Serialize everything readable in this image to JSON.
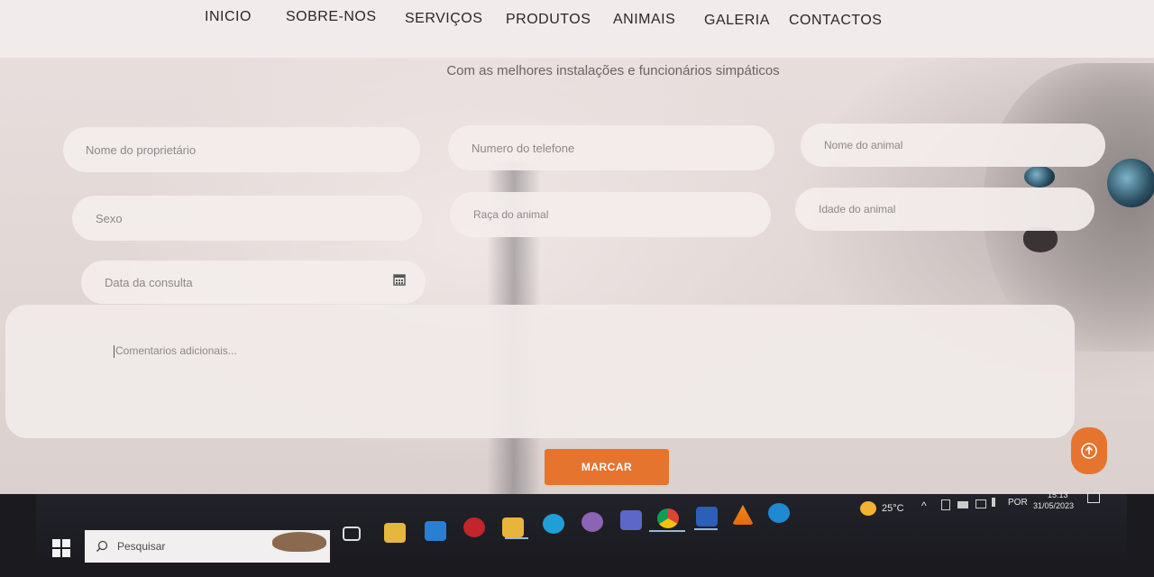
{
  "nav": {
    "items": [
      "INICIO",
      "SOBRE-NOS",
      "SERVIÇOS",
      "PRODUTOS",
      "ANIMAIS",
      "GALERIA",
      "CONTACTOS"
    ]
  },
  "hero": {
    "subtitle": "Com as melhores instalações e funcionários simpáticos"
  },
  "form": {
    "owner_name_placeholder": "Nome do proprietário",
    "phone_placeholder": "Numero do telefone",
    "animal_name_placeholder": "Nome do animal",
    "sex_placeholder": "Sexo",
    "breed_placeholder": "Raça do animal",
    "age_placeholder": "Idade do animal",
    "date_placeholder": "Data da consulta",
    "comments_placeholder": "Comentarios adicionais...",
    "submit_label": "MARCAR"
  },
  "taskbar": {
    "search_placeholder": "Pesquisar",
    "temperature": "25°C",
    "language": "POR",
    "time": "15:13",
    "date": "31/05/2023"
  },
  "colors": {
    "accent": "#e5742f",
    "nav_bg": "#f1eceb",
    "taskbar_bg": "#1b1a1f"
  }
}
